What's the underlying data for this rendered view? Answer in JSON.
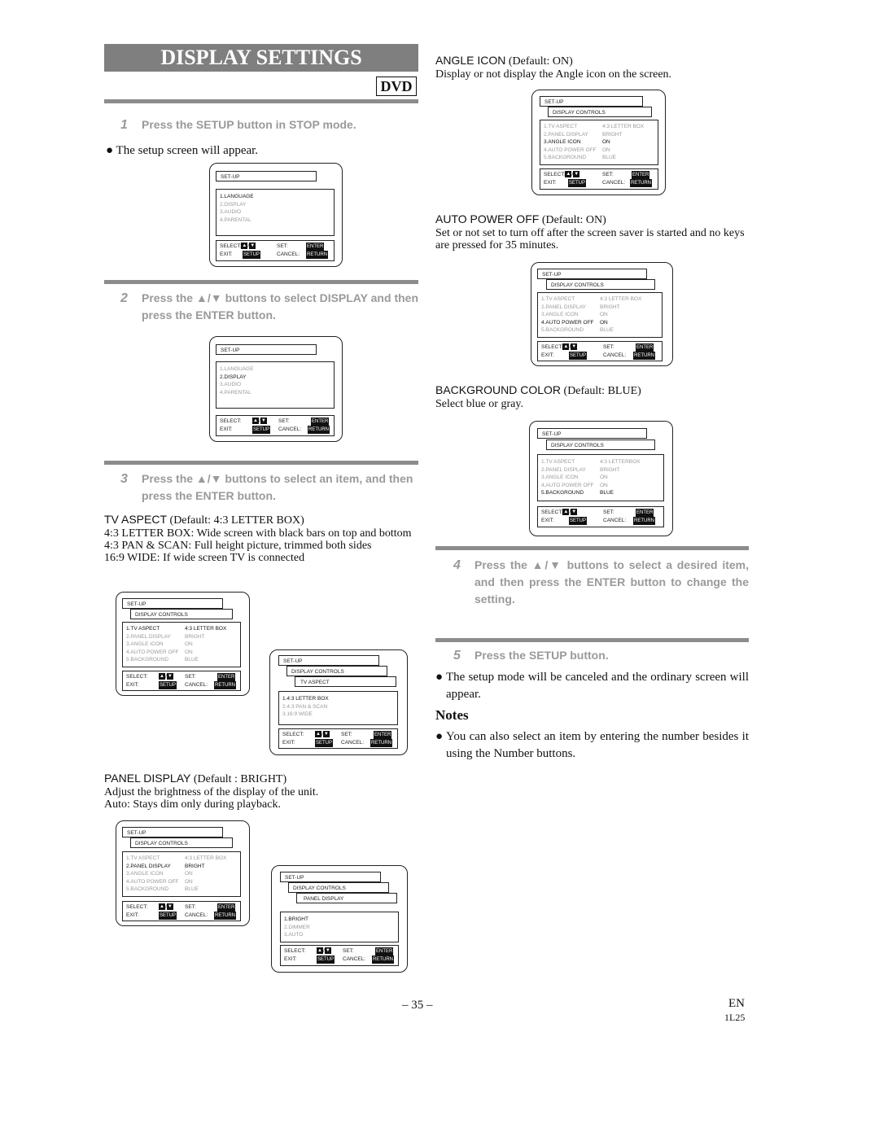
{
  "title": "DISPLAY SETTINGS",
  "badge": "DVD",
  "steps": [
    {
      "num": "1",
      "text": "Press the SETUP button in STOP mode."
    },
    {
      "num": "2",
      "text": "Press the ▲/▼ buttons to select DISPLAY and then press the ENTER button."
    },
    {
      "num": "3",
      "text": "Press the ▲/▼ buttons to select an item, and then press the ENTER button."
    },
    {
      "num": "4",
      "text": "Press the ▲/▼ buttons to select a desired item, and then press the ENTER button to change the setting."
    },
    {
      "num": "5",
      "text": "Press the SETUP button."
    }
  ],
  "bullets": {
    "setup_appear": "The setup screen will appear.",
    "setup_cancel": "The setup mode will be canceled and the ordinary screen will appear."
  },
  "sections": {
    "tv_aspect": {
      "label": "TV ASPECT",
      "default": "(Default: 4:3 LETTER BOX)",
      "lines": [
        "4:3 LETTER BOX: Wide screen with black bars on top and bottom",
        "4:3 PAN & SCAN: Full height picture, trimmed both sides",
        "16:9 WIDE: If wide screen TV is connected"
      ]
    },
    "panel_display": {
      "label": "PANEL DISPLAY",
      "default": "(Default : BRIGHT)",
      "lines": [
        "Adjust the brightness of the display of the unit.",
        "Auto: Stays dim only during playback."
      ]
    },
    "angle_icon": {
      "label": "ANGLE ICON",
      "default": "(Default: ON)",
      "lines": [
        "Display or not display the Angle icon on the screen."
      ]
    },
    "auto_power_off": {
      "label": "AUTO POWER OFF",
      "default": "(Default: ON)",
      "lines": [
        "Set or not set to turn off after the screen saver is started and no keys are pressed for 35 minutes."
      ]
    },
    "background_color": {
      "label": "BACKGROUND COLOR",
      "default": "(Default: BLUE)",
      "lines": [
        "Select blue or gray."
      ]
    }
  },
  "notes": {
    "heading": "Notes",
    "items": [
      "You can also select an item by entering the number besides it using the Number buttons."
    ]
  },
  "osd": {
    "setup": "SET-UP",
    "display_controls": "DISPLAY CONTROLS",
    "tv_aspect_tab": "TV ASPECT",
    "panel_display_tab": "PANEL DISPLAY",
    "main_menu": [
      "1.LANGUAGE",
      "2.DISPLAY",
      "3.AUDIO",
      "4.PARENTAL"
    ],
    "dc_items": [
      "1.TV ASPECT",
      "2.PANEL DISPLAY",
      "3.ANGLE ICON",
      "4.AUTO POWER OFF",
      "5.BACKGROUND"
    ],
    "dc_values": [
      "4:3 LETTER BOX",
      "BRIGHT",
      "ON",
      "ON",
      "BLUE"
    ],
    "dc_values_alt_letterbox": "4:3 LETTERBOX",
    "aspect_options": [
      "1.4:3 LETTER BOX",
      "2.4:3 PAN & SCAN",
      "3.16:9 WIDE"
    ],
    "panel_options": [
      "1.BRIGHT",
      "2.DIMMER",
      "3.AUTO"
    ],
    "select_label": "SELECT:",
    "set_label": "SET:",
    "exit_label": "EXIT:",
    "cancel_label": "CANCEL:",
    "up_icon": "▲",
    "down_icon": "▼",
    "enter_key": "ENTER",
    "setup_key": "SETUP",
    "return_key": "RETURN"
  },
  "footer": {
    "page": "– 35 –",
    "lang": "EN",
    "code": "1L25"
  }
}
